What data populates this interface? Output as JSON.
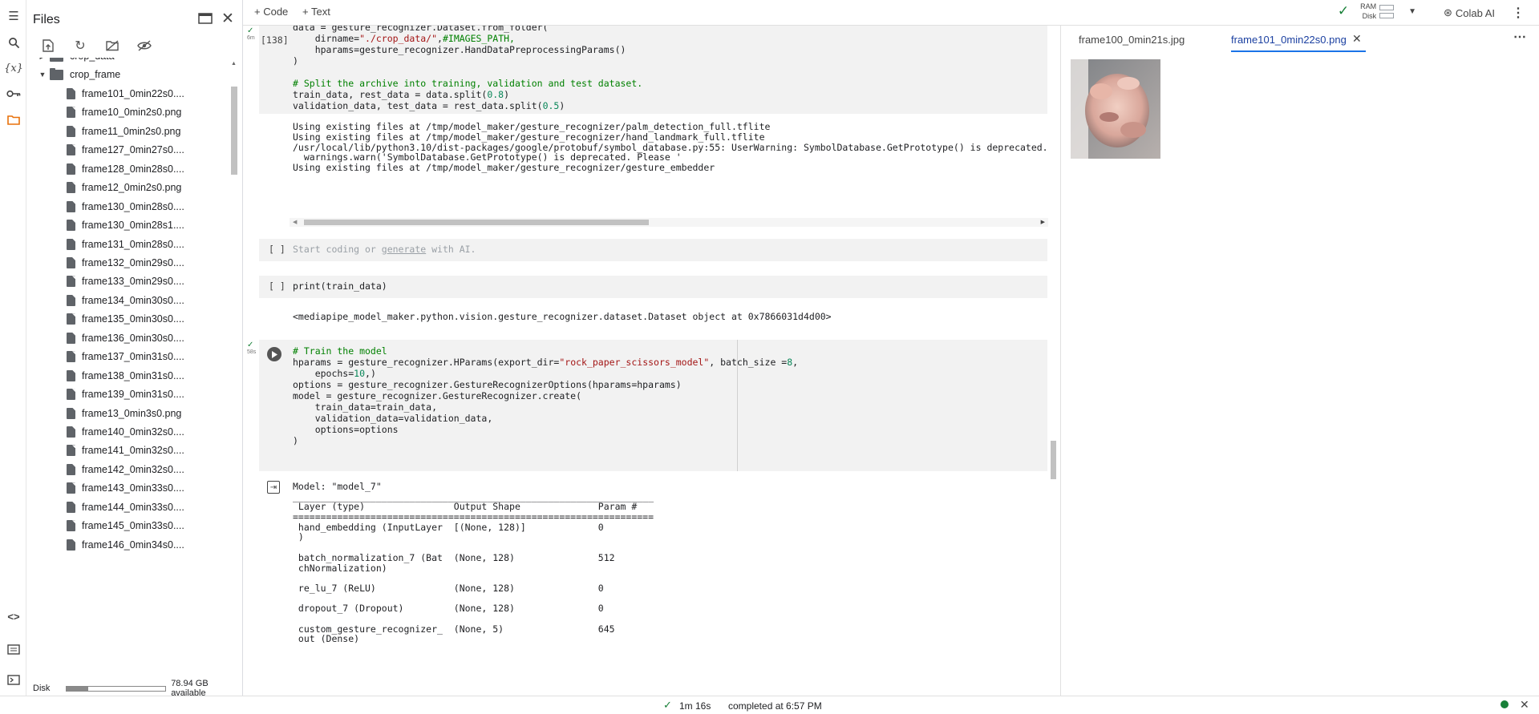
{
  "rail": {
    "icons": [
      "toc-icon",
      "search-icon",
      "variables-icon",
      "key-icon",
      "folder-icon",
      "code-snippets-icon",
      "command-palette-icon",
      "terminal-icon"
    ]
  },
  "files": {
    "title": "Files",
    "items": [
      {
        "name": "crop_data",
        "type": "folder",
        "expanded": false
      },
      {
        "name": "crop_frame",
        "type": "folder",
        "expanded": true
      },
      {
        "name": "frame101_0min22s0....",
        "type": "file"
      },
      {
        "name": "frame10_0min2s0.png",
        "type": "file"
      },
      {
        "name": "frame11_0min2s0.png",
        "type": "file"
      },
      {
        "name": "frame127_0min27s0....",
        "type": "file"
      },
      {
        "name": "frame128_0min28s0....",
        "type": "file"
      },
      {
        "name": "frame12_0min2s0.png",
        "type": "file"
      },
      {
        "name": "frame130_0min28s0....",
        "type": "file"
      },
      {
        "name": "frame130_0min28s1....",
        "type": "file"
      },
      {
        "name": "frame131_0min28s0....",
        "type": "file"
      },
      {
        "name": "frame132_0min29s0....",
        "type": "file"
      },
      {
        "name": "frame133_0min29s0....",
        "type": "file"
      },
      {
        "name": "frame134_0min30s0....",
        "type": "file"
      },
      {
        "name": "frame135_0min30s0....",
        "type": "file"
      },
      {
        "name": "frame136_0min30s0....",
        "type": "file"
      },
      {
        "name": "frame137_0min31s0....",
        "type": "file"
      },
      {
        "name": "frame138_0min31s0....",
        "type": "file"
      },
      {
        "name": "frame139_0min31s0....",
        "type": "file"
      },
      {
        "name": "frame13_0min3s0.png",
        "type": "file"
      },
      {
        "name": "frame140_0min32s0....",
        "type": "file"
      },
      {
        "name": "frame141_0min32s0....",
        "type": "file"
      },
      {
        "name": "frame142_0min32s0....",
        "type": "file"
      },
      {
        "name": "frame143_0min33s0....",
        "type": "file"
      },
      {
        "name": "frame144_0min33s0....",
        "type": "file"
      },
      {
        "name": "frame145_0min33s0....",
        "type": "file"
      },
      {
        "name": "frame146_0min34s0....",
        "type": "file"
      }
    ],
    "disk_label": "Disk",
    "disk_available": "78.94 GB available",
    "disk_used_fraction": 0.22
  },
  "toolbar": {
    "code_label": "+ Code",
    "text_label": "+ Text",
    "ram_label": "RAM",
    "disk_label": "Disk",
    "colab_ai_label": "Colab AI"
  },
  "cells": {
    "c1": {
      "exec_count": "[138]",
      "exec_time": "6m",
      "lines": [
        "data = gesture_recognizer.Dataset.from_folder(",
        "    dirname=\"./crop_data/\",#IMAGES_PATH,",
        "    hparams=gesture_recognizer.HandDataPreprocessingParams()",
        ")",
        "",
        "# Split the archive into training, validation and test dataset.",
        "train_data, rest_data = data.split(0.8)",
        "validation_data, test_data = rest_data.split(0.5)"
      ],
      "output": [
        "Using existing files at /tmp/model_maker/gesture_recognizer/palm_detection_full.tflite",
        "Using existing files at /tmp/model_maker/gesture_recognizer/hand_landmark_full.tflite",
        "/usr/local/lib/python3.10/dist-packages/google/protobuf/symbol_database.py:55: UserWarning: SymbolDatabase.GetPrototype() is deprecated.",
        "  warnings.warn('SymbolDatabase.GetPrototype() is deprecated. Please '",
        "Using existing files at /tmp/model_maker/gesture_recognizer/gesture_embedder"
      ]
    },
    "c2": {
      "exec_count": "[ ]",
      "placeholder_pre": "Start coding or ",
      "placeholder_link": "generate",
      "placeholder_post": " with AI."
    },
    "c3": {
      "exec_count": "[ ]",
      "code": "print(train_data)",
      "output": "<mediapipe_model_maker.python.vision.gesture_recognizer.dataset.Dataset object at 0x7866031d4d00>"
    },
    "c4": {
      "exec_time": "58s",
      "lines": [
        "# Train the model",
        "hparams = gesture_recognizer.HParams(export_dir=\"rock_paper_scissors_model\", batch_size =8,",
        "    epochs=10,)",
        "options = gesture_recognizer.GestureRecognizerOptions(hparams=hparams)",
        "model = gesture_recognizer.GestureRecognizer.create(",
        "    train_data=train_data,",
        "    validation_data=validation_data,",
        "    options=options",
        ")"
      ],
      "output": [
        "Model: \"model_7\"",
        "_________________________________________________________________",
        " Layer (type)                Output Shape              Param #   ",
        "=================================================================",
        " hand_embedding (InputLayer  [(None, 128)]             0         ",
        " )                                                               ",
        "                                                                 ",
        " batch_normalization_7 (Bat  (None, 128)               512       ",
        " chNormalization)                                                ",
        "                                                                 ",
        " re_lu_7 (ReLU)              (None, 128)               0         ",
        "                                                                 ",
        " dropout_7 (Dropout)         (None, 128)               0         ",
        "                                                                 ",
        " custom_gesture_recognizer_  (None, 5)                 645       ",
        " out (Dense)                                                     "
      ]
    }
  },
  "right": {
    "tab1": "frame100_0min21s.jpg",
    "tab2": "frame101_0min22s0.png"
  },
  "status": {
    "time": "1m 16s",
    "completed": "completed at 6:57 PM"
  }
}
